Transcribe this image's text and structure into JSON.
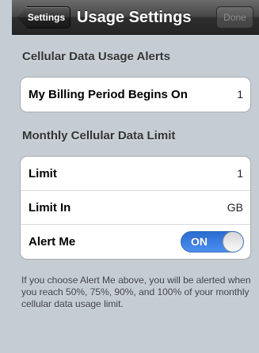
{
  "navbar": {
    "back_label": "Settings",
    "title": "Usage Settings",
    "done_label": "Done"
  },
  "section1": {
    "header": "Cellular Data Usage Alerts",
    "rows": [
      {
        "label": "My Billing Period Begins On",
        "value": "1"
      }
    ]
  },
  "section2": {
    "header": "Monthly Cellular Data Limit",
    "rows": [
      {
        "label": "Limit",
        "value": "1"
      },
      {
        "label": "Limit In",
        "value": "GB"
      },
      {
        "label": "Alert Me",
        "toggle_label": "ON",
        "toggle_state": "on"
      }
    ]
  },
  "footer": "If you choose Alert Me above, you will be alerted when you reach 50%, 75%, 90%, and 100% of your monthly cellular data usage limit.",
  "colors": {
    "background": "#c5ccd4",
    "toggle_on": "#2a6bd0"
  }
}
